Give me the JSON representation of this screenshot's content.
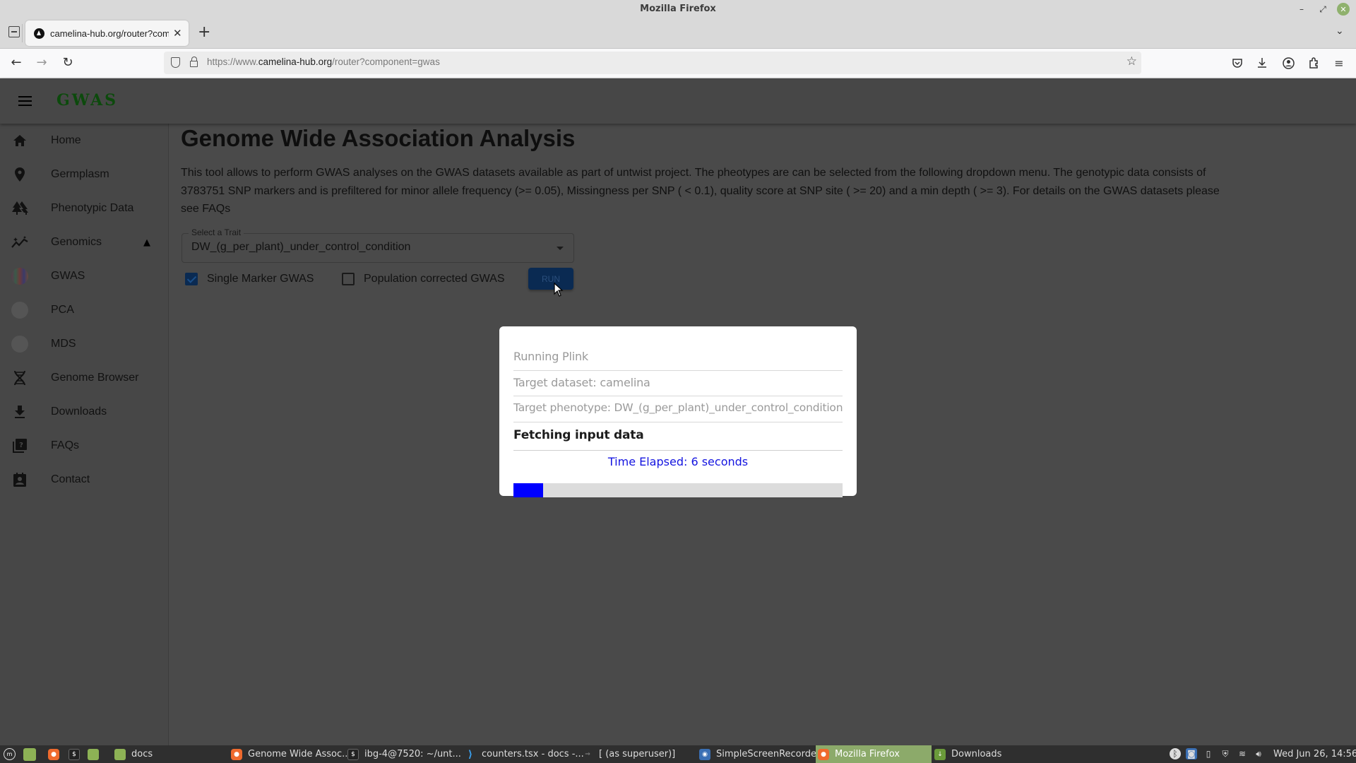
{
  "window": {
    "title": "Mozilla Firefox"
  },
  "browser": {
    "tab_title": "camelina-hub.org/router?component=gwas",
    "url_prefix": "https://www.",
    "url_domain": "camelina-hub.org",
    "url_path": "/router?component=gwas",
    "new_tab_label": "+"
  },
  "app": {
    "logo": "GWAS",
    "sidebar": {
      "items": [
        {
          "label": "Home",
          "icon": "home-icon"
        },
        {
          "label": "Germplasm",
          "icon": "location-pin-icon"
        },
        {
          "label": "Phenotypic Data",
          "icon": "trees-icon"
        },
        {
          "label": "Genomics",
          "icon": "analytics-icon",
          "expanded": true
        },
        {
          "label": "GWAS",
          "icon": "gwas-thumbnail-icon"
        },
        {
          "label": "PCA",
          "icon": "pca-thumbnail-icon"
        },
        {
          "label": "MDS",
          "icon": "mds-thumbnail-icon"
        },
        {
          "label": "Genome Browser",
          "icon": "dna-icon"
        },
        {
          "label": "Downloads",
          "icon": "download-icon"
        },
        {
          "label": "FAQs",
          "icon": "faq-icon"
        },
        {
          "label": "Contact",
          "icon": "contact-icon"
        }
      ]
    },
    "main": {
      "title": "Genome Wide Association Analysis",
      "description": "This tool allows to perform GWAS analyses on the GWAS datasets available as part of untwist project. The pheotypes are can be selected from the following dropdown menu. The genotypic data consists of 3783751 SNP markers and is prefiltered for minor allele frequency (>= 0.05), Missingness per SNP ( < 0.1), quality score at SNP site ( >= 20) and a min depth ( >= 3). For details on the GWAS datasets please see FAQs",
      "trait_select": {
        "label": "Select a Trait",
        "value": "DW_(g_per_plant)_under_control_condition"
      },
      "checkboxes": [
        {
          "label": "Single Marker GWAS",
          "checked": true
        },
        {
          "label": "Population corrected GWAS",
          "checked": false
        }
      ],
      "run_label": "RUN"
    },
    "modal": {
      "steps": [
        "Running Plink",
        "Target dataset: camelina",
        "Target phenotype: DW_(g_per_plant)_under_control_condition"
      ],
      "current_step": "Fetching input data",
      "elapsed": "Time Elapsed: 6 seconds",
      "progress_percent": 9,
      "progress_color": "#0000ff"
    }
  },
  "taskbar": {
    "launchers": [
      "menu",
      "show-desktop",
      "firefox",
      "terminal",
      "files"
    ],
    "windows": [
      {
        "label": "docs",
        "icon": "folder"
      },
      {
        "label": "Genome Wide Assoc...",
        "icon": "firefox"
      },
      {
        "label": "ibg-4@7520: ~/unt...",
        "icon": "terminal"
      },
      {
        "label": "counters.tsx - docs -...",
        "icon": "vscode"
      },
      {
        "label": "[ (as superuser)]",
        "icon": "app"
      },
      {
        "label": "SimpleScreenRecorder",
        "icon": "ssr"
      },
      {
        "label": "Mozilla Firefox",
        "icon": "firefox",
        "active": true
      },
      {
        "label": "Downloads",
        "icon": "downloads-folder"
      }
    ],
    "clock": "Wed Jun 26, 14:56"
  }
}
